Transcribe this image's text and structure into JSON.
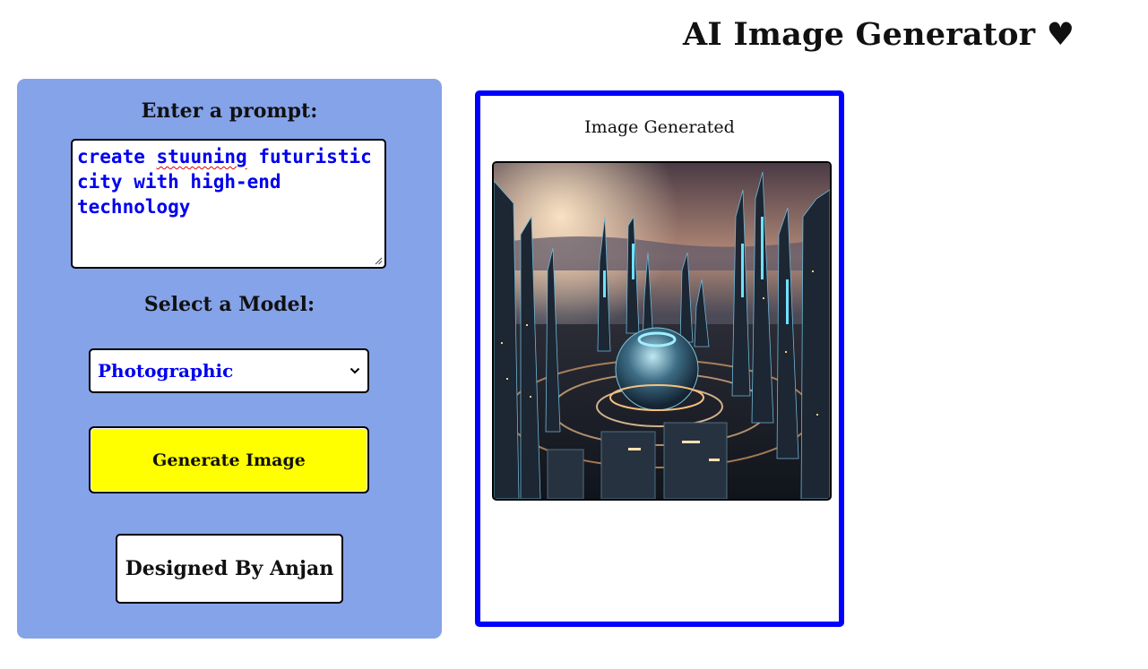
{
  "header": {
    "title": "AI Image Generator ♥"
  },
  "controls": {
    "prompt_label": "Enter a prompt:",
    "prompt_value": {
      "part1": "create ",
      "misspelled": "stuuning",
      "part2": " futuristic city with high-end technology"
    },
    "model_label": "Select a Model:",
    "model_selected": "Photographic",
    "generate_label": "Generate Image",
    "credit": "Designed By Anjan"
  },
  "result": {
    "label": "Image Generated",
    "image_icon": "futuristic-city-image"
  },
  "colors": {
    "panel_bg": "#85a3e9",
    "button_bg": "#ffff00",
    "result_border": "#0000ff",
    "input_text": "#0000ee"
  }
}
